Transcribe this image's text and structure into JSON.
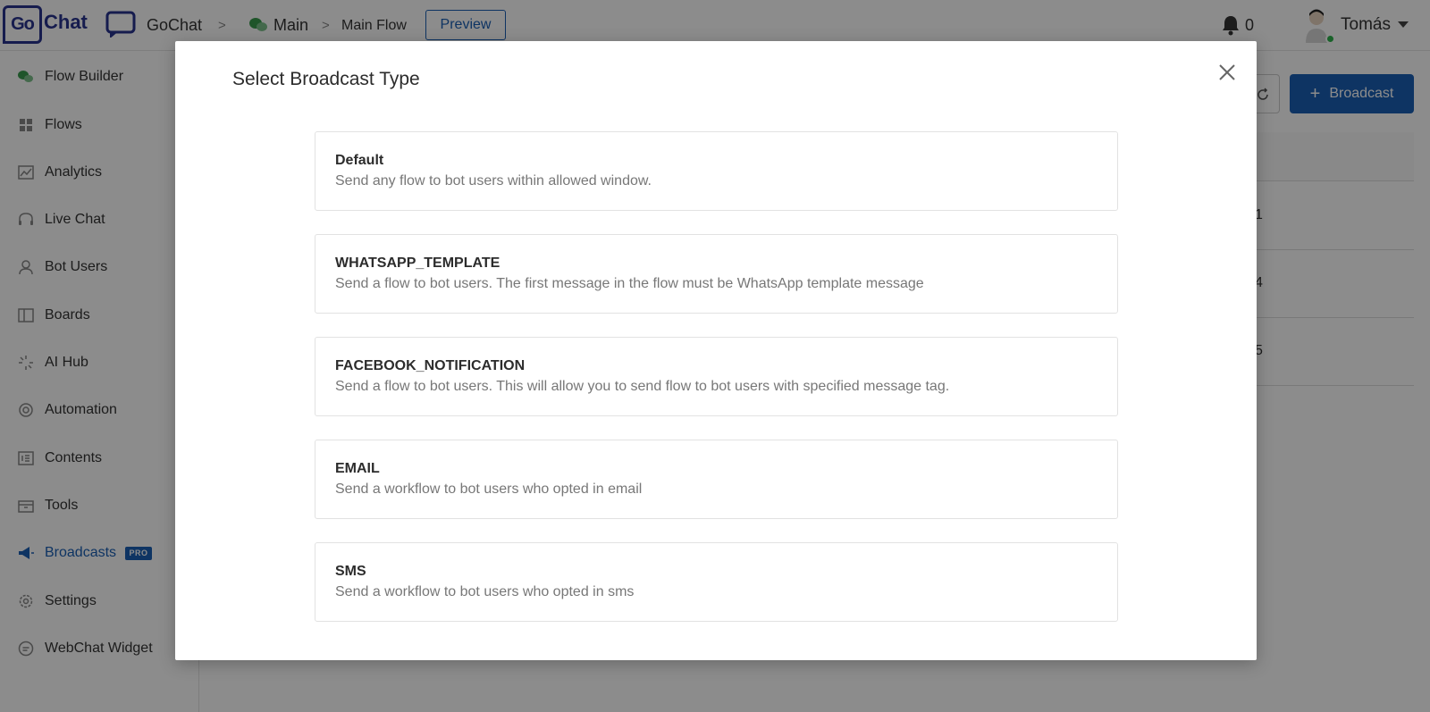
{
  "logo": {
    "mark": "Go",
    "text": "Chat"
  },
  "breadcrumb": {
    "bot_name": "GoChat",
    "main": "Main",
    "flow": "Main Flow",
    "separator": ">"
  },
  "header": {
    "preview_label": "Preview",
    "notification_count": "0",
    "user_name": "Tomás"
  },
  "sidebar": {
    "items": [
      {
        "label": "Flow Builder",
        "icon": "chat-bubbles-icon"
      },
      {
        "label": "Flows",
        "icon": "grid-icon"
      },
      {
        "label": "Analytics",
        "icon": "chart-icon"
      },
      {
        "label": "Live Chat",
        "icon": "headset-icon"
      },
      {
        "label": "Bot Users",
        "icon": "user-icon"
      },
      {
        "label": "Boards",
        "icon": "board-icon"
      },
      {
        "label": "AI Hub",
        "icon": "sparkle-icon"
      },
      {
        "label": "Automation",
        "icon": "automation-icon"
      },
      {
        "label": "Contents",
        "icon": "contents-icon"
      },
      {
        "label": "Tools",
        "icon": "toolbox-icon"
      },
      {
        "label": "Broadcasts",
        "icon": "megaphone-icon",
        "badge": "PRO",
        "active": true
      },
      {
        "label": "Settings",
        "icon": "gear-icon"
      },
      {
        "label": "WebChat Widget",
        "icon": "webchat-icon"
      }
    ]
  },
  "page": {
    "broadcast_button_label": "Broadcast",
    "table_cells": [
      "1",
      "4",
      "5"
    ]
  },
  "modal": {
    "title": "Select Broadcast Type",
    "options": [
      {
        "title": "Default",
        "description": "Send any flow to bot users within allowed window."
      },
      {
        "title": "WHATSAPP_TEMPLATE",
        "description": "Send a flow to bot users. The first message in the flow must be WhatsApp template message"
      },
      {
        "title": "FACEBOOK_NOTIFICATION",
        "description": "Send a flow to bot users. This will allow you to send flow to bot users with specified message tag."
      },
      {
        "title": "EMAIL",
        "description": "Send a workflow to bot users who opted in email"
      },
      {
        "title": "SMS",
        "description": "Send a workflow to bot users who opted in sms"
      }
    ]
  },
  "colors": {
    "brand": "#28338f",
    "accent": "#1b5fb4",
    "online": "#2eb24b"
  }
}
